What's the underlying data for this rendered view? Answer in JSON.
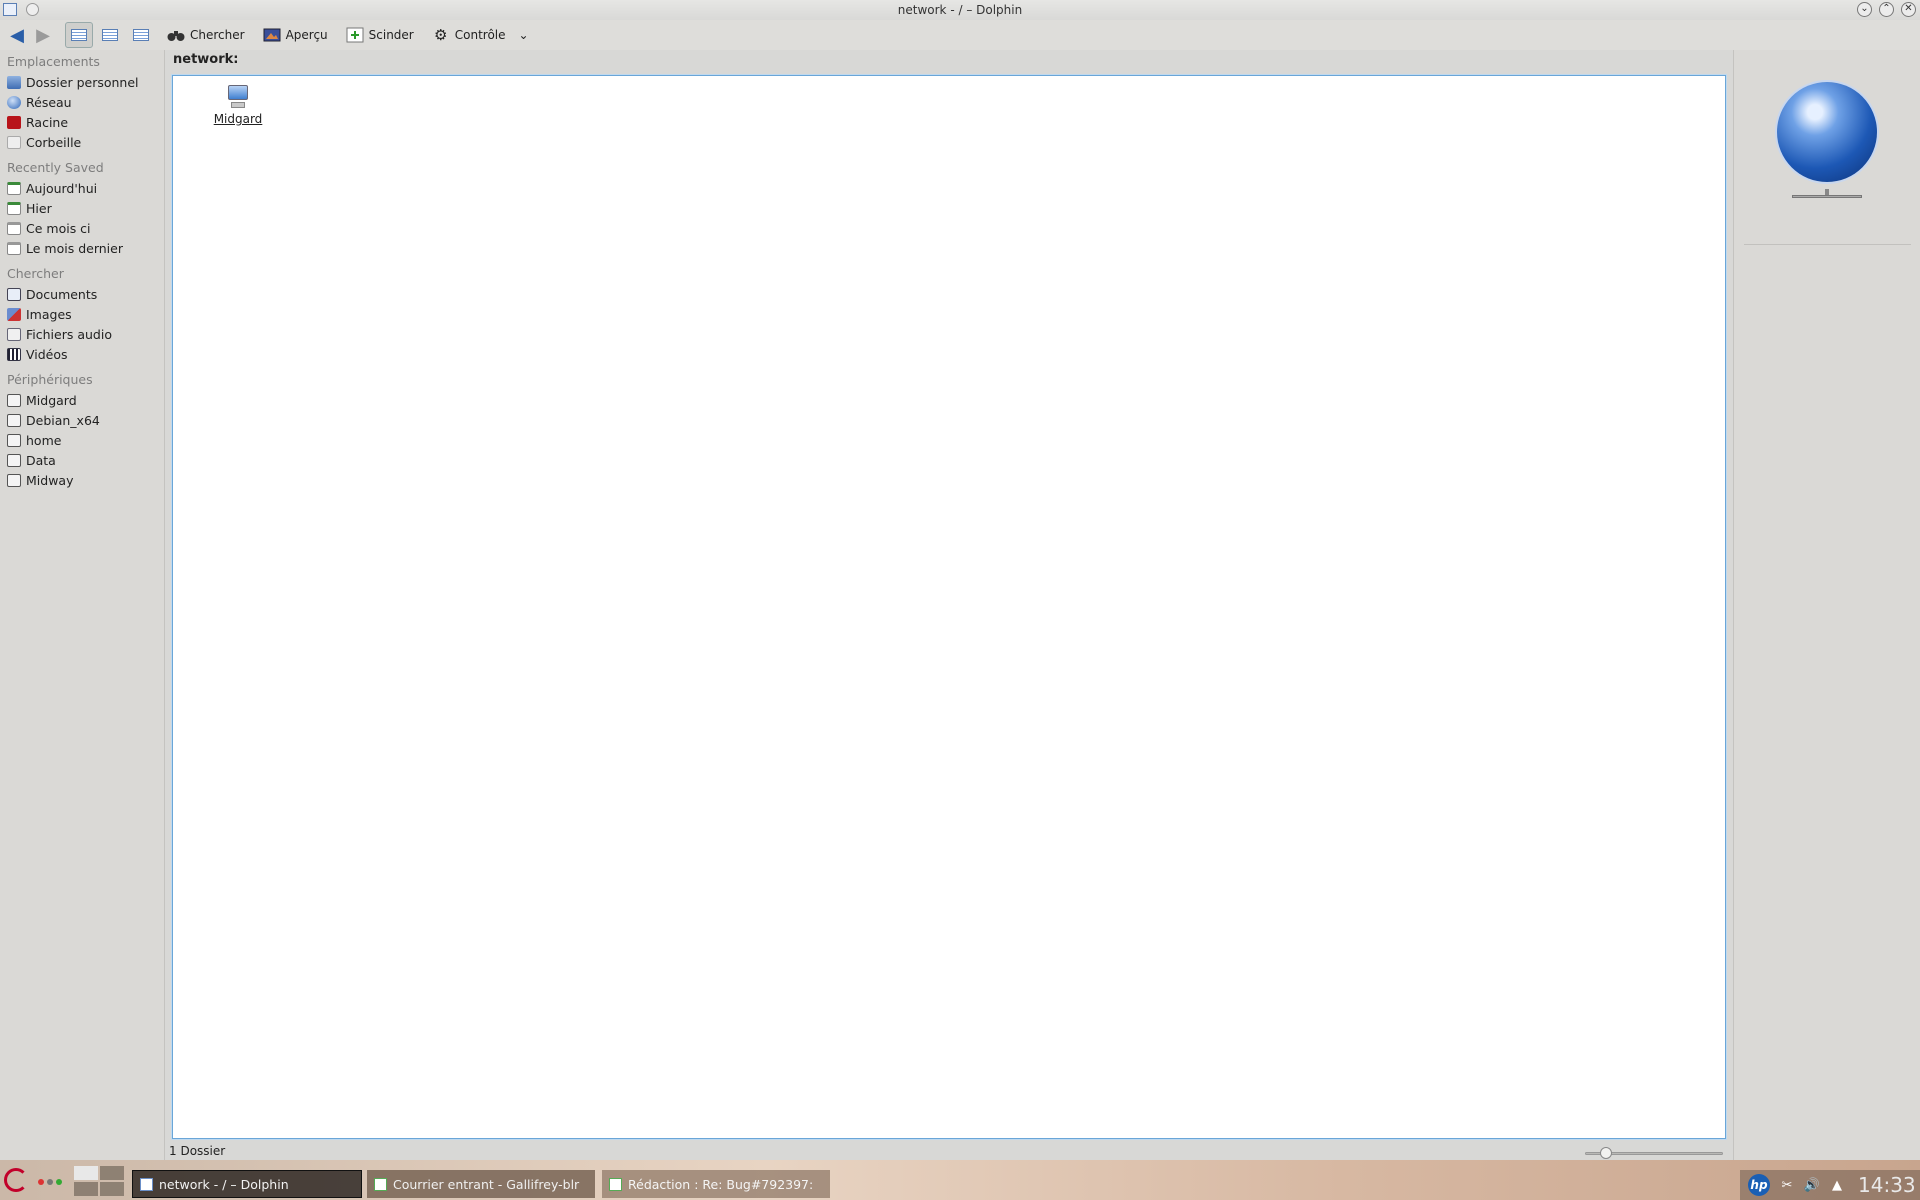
{
  "window": {
    "title": "network - / – Dolphin",
    "buttons": [
      "⌄",
      "⌃",
      "✕"
    ]
  },
  "toolbar": {
    "back_icon": "◀",
    "forward_icon": "▶",
    "search_label": "Chercher",
    "search_icon": "binoculars-icon",
    "preview_label": "Aperçu",
    "preview_icon": "preview-icon",
    "split_label": "Scinder",
    "split_icon": "split-icon",
    "control_label": "Contrôle",
    "control_icon": "⚙",
    "more_icon": "⌄"
  },
  "sidebar": {
    "places_heading": "Emplacements",
    "places": [
      {
        "label": "Dossier personnel",
        "icon": "home-folder-icon"
      },
      {
        "label": "Réseau",
        "icon": "network-icon"
      },
      {
        "label": "Racine",
        "icon": "root-folder-icon"
      },
      {
        "label": "Corbeille",
        "icon": "trash-icon"
      }
    ],
    "recent_heading": "Recently Saved",
    "recent": [
      {
        "label": "Aujourd'hui",
        "icon": "calendar-today-icon"
      },
      {
        "label": "Hier",
        "icon": "calendar-yesterday-icon"
      },
      {
        "label": "Ce mois ci",
        "icon": "calendar-month-icon"
      },
      {
        "label": "Le mois dernier",
        "icon": "calendar-last-month-icon"
      }
    ],
    "search_heading": "Chercher",
    "search": [
      {
        "label": "Documents",
        "icon": "documents-icon"
      },
      {
        "label": "Images",
        "icon": "images-icon"
      },
      {
        "label": "Fichiers audio",
        "icon": "audio-icon"
      },
      {
        "label": "Vidéos",
        "icon": "video-icon"
      }
    ],
    "devices_heading": "Périphériques",
    "devices": [
      {
        "label": "Midgard",
        "icon": "drive-icon"
      },
      {
        "label": "Debian_x64",
        "icon": "drive-icon"
      },
      {
        "label": "home",
        "icon": "drive-icon"
      },
      {
        "label": "Data",
        "icon": "drive-icon"
      },
      {
        "label": "Midway",
        "icon": "drive-icon"
      }
    ]
  },
  "location": {
    "path": "network:"
  },
  "files": [
    {
      "name": "Midgard",
      "icon": "computer-icon"
    }
  ],
  "status": {
    "text": "1 Dossier",
    "zoom_fraction": 0.12
  },
  "taskbar": {
    "tasks": [
      {
        "label": "network - / – Dolphin",
        "active": true
      },
      {
        "label": "Courrier entrant - Gallifrey-blr",
        "active": false
      },
      {
        "label": "Rédaction : Re: Bug#792397:",
        "active": false
      }
    ],
    "tray": {
      "hp_label": "hp",
      "clock": "14:33"
    }
  },
  "colors": {
    "accent": "#6aa6d8",
    "debian_red": "#c2002a"
  }
}
